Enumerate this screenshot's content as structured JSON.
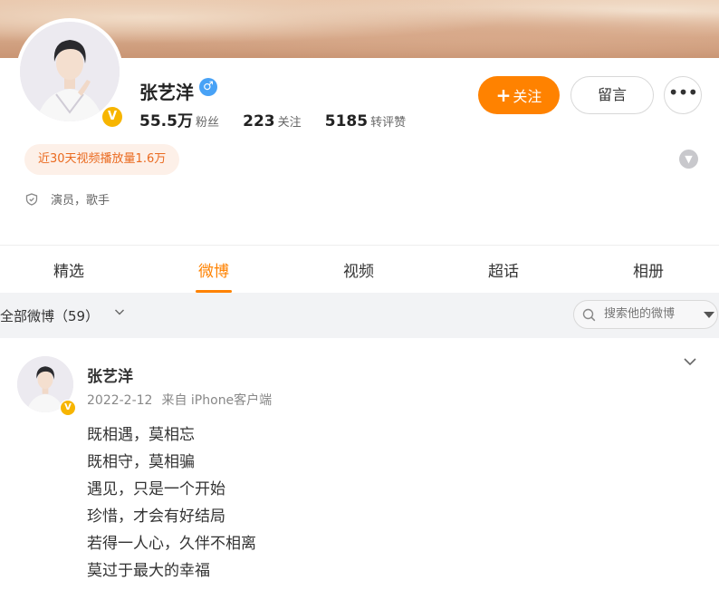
{
  "profile": {
    "name": "张艺洋",
    "gender_icon": "male-icon",
    "verified_icon": "verified-v-icon",
    "stats": [
      {
        "value": "55.5万",
        "label": "粉丝"
      },
      {
        "value": "223",
        "label": "关注"
      },
      {
        "value": "5185",
        "label": "转评赞"
      }
    ],
    "follow_label": "关注",
    "message_label": "留言",
    "more_label": "•••",
    "play_badge": "近30天视频播放量1.6万",
    "bio": "演员，歌手"
  },
  "tabs": [
    {
      "label": "精选",
      "active": false
    },
    {
      "label": "微博",
      "active": true
    },
    {
      "label": "视频",
      "active": false
    },
    {
      "label": "超话",
      "active": false
    },
    {
      "label": "相册",
      "active": false
    }
  ],
  "filter": {
    "label": "全部微博（59）",
    "search_placeholder": "搜索他的微博"
  },
  "post": {
    "author": "张艺洋",
    "date": "2022-2-12",
    "source": "来自 iPhone客户端",
    "lines": [
      "既相遇，莫相忘",
      "既相守，莫相骗",
      "遇见，只是一个开始",
      "珍惜，才会有好结局",
      "若得一人心，久伴不相离",
      "莫过于最大的幸福"
    ]
  },
  "colors": {
    "accent": "#ff8200",
    "verified": "#f7b500",
    "gender": "#48a2f6"
  }
}
